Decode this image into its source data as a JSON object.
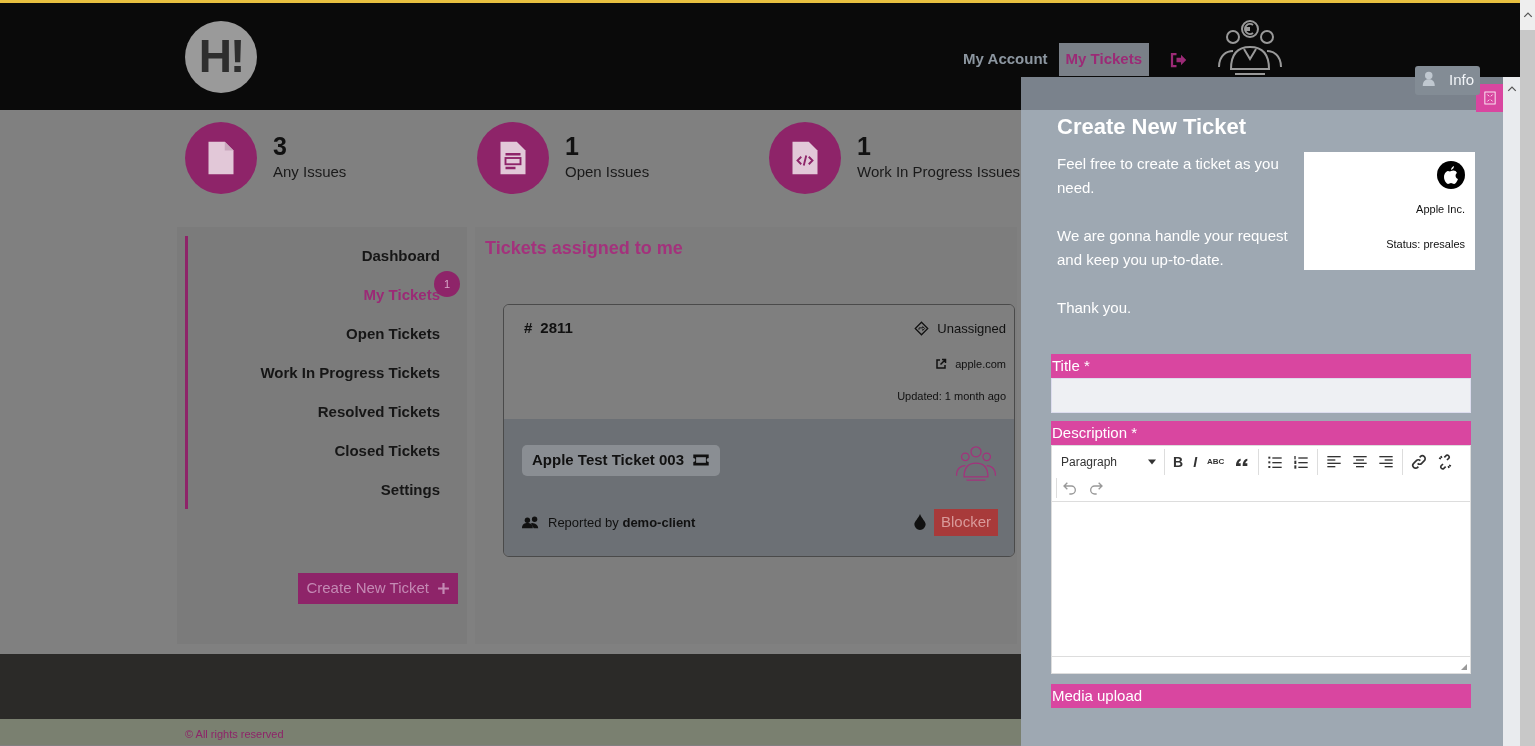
{
  "header": {
    "logo": "H!",
    "nav": [
      {
        "label": "My Account",
        "selected": false
      },
      {
        "label": "My Tickets",
        "selected": true
      }
    ],
    "info_button": "Info"
  },
  "stats": [
    {
      "kind": "file",
      "value": "3",
      "label": "Any Issues"
    },
    {
      "kind": "form",
      "value": "1",
      "label": "Open Issues"
    },
    {
      "kind": "code",
      "value": "1",
      "label": "Work In Progress Issues"
    }
  ],
  "sidebar": {
    "items": [
      {
        "label": "Dashboard",
        "selected": false
      },
      {
        "label": "My Tickets",
        "selected": true,
        "badge": "1"
      },
      {
        "label": "Open Tickets",
        "selected": false
      },
      {
        "label": "Work In Progress Tickets",
        "selected": false
      },
      {
        "label": "Resolved Tickets",
        "selected": false
      },
      {
        "label": "Closed Tickets",
        "selected": false
      },
      {
        "label": "Settings",
        "selected": false
      }
    ],
    "create_button": "Create New Ticket"
  },
  "tickets": {
    "title": "Tickets assigned to me",
    "cards": [
      {
        "hash": "#",
        "number": "2811",
        "assignee": "Unassigned",
        "link": "apple.com",
        "updated": "Updated: 1 month ago",
        "subject": "Apple Test Ticket 003",
        "reporter": "Reported by **demo-client**",
        "urgency": "Blocker"
      }
    ]
  },
  "panel": {
    "title": "Create New Ticket",
    "paragraphs": [
      "Feel free to create a ticket as you need.",
      "We are gonna handle your request and keep you up-to-date.",
      "Thank you."
    ],
    "company": {
      "name": "Apple Inc.",
      "status": "Status: presales"
    },
    "form": {
      "title_label": "Title *",
      "description_label": "Description *",
      "block_format": "Paragraph",
      "format_buttons": [
        "B",
        "I",
        "ABC"
      ],
      "media_label": "Media upload"
    }
  },
  "footer": {
    "copyright": "© All rights reserved"
  }
}
